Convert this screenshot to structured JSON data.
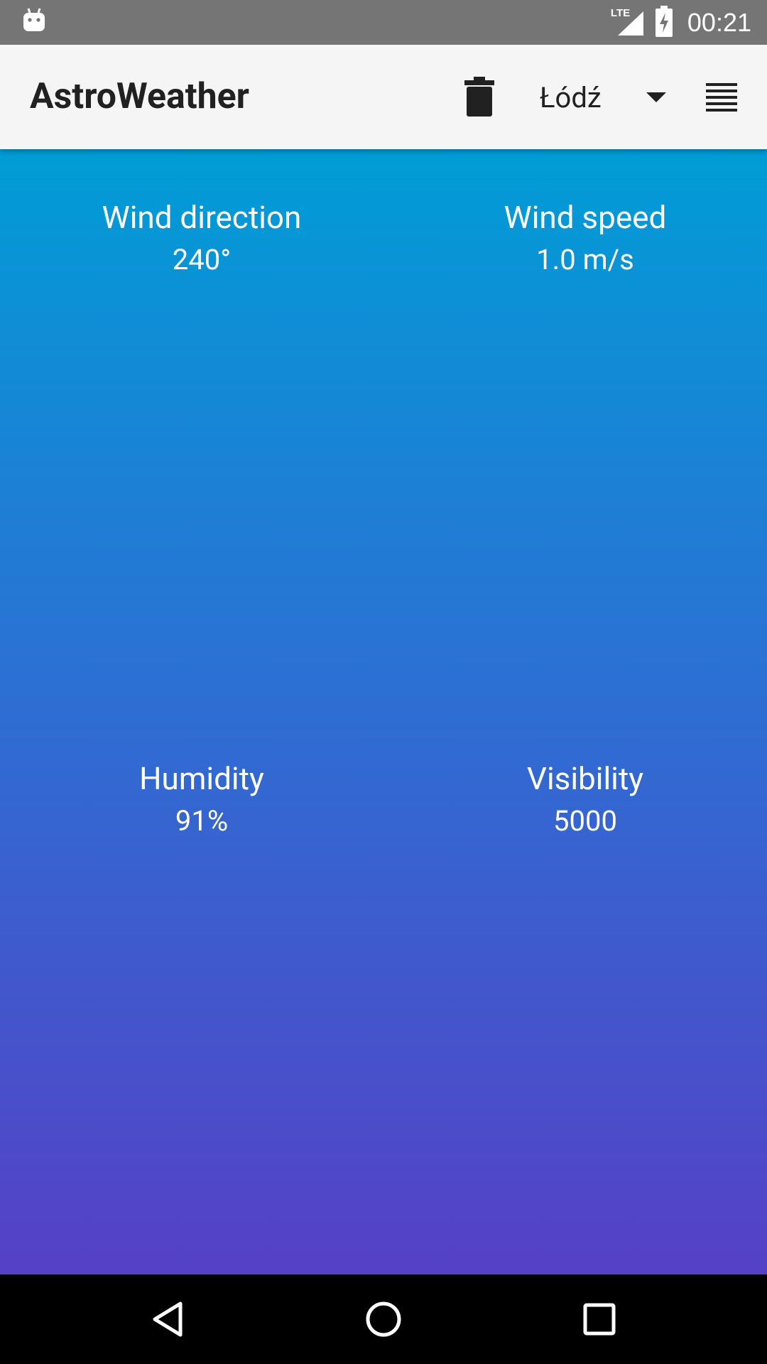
{
  "status_bar": {
    "time": "00:21",
    "network_label": "LTE",
    "icons": [
      "android-debug-icon",
      "signal-icon",
      "battery-charging-icon"
    ]
  },
  "app_bar": {
    "title": "AstroWeather",
    "selected_city": "Łódź",
    "icons": [
      "trash-icon",
      "dropdown-arrow-icon",
      "menu-list-icon"
    ]
  },
  "weather": {
    "wind_direction": {
      "label": "Wind direction",
      "value": "240°"
    },
    "wind_speed": {
      "label": "Wind speed",
      "value": "1.0 m/s"
    },
    "humidity": {
      "label": "Humidity",
      "value": "91%"
    },
    "visibility": {
      "label": "Visibility",
      "value": "5000"
    }
  },
  "nav_bar": {
    "icons": [
      "back-icon",
      "home-icon",
      "recents-icon"
    ]
  },
  "colors": {
    "status_bar": "#757575",
    "app_bar": "#f5f5f5",
    "gradient_top": "#009dd6",
    "gradient_bottom": "#5640c6"
  }
}
